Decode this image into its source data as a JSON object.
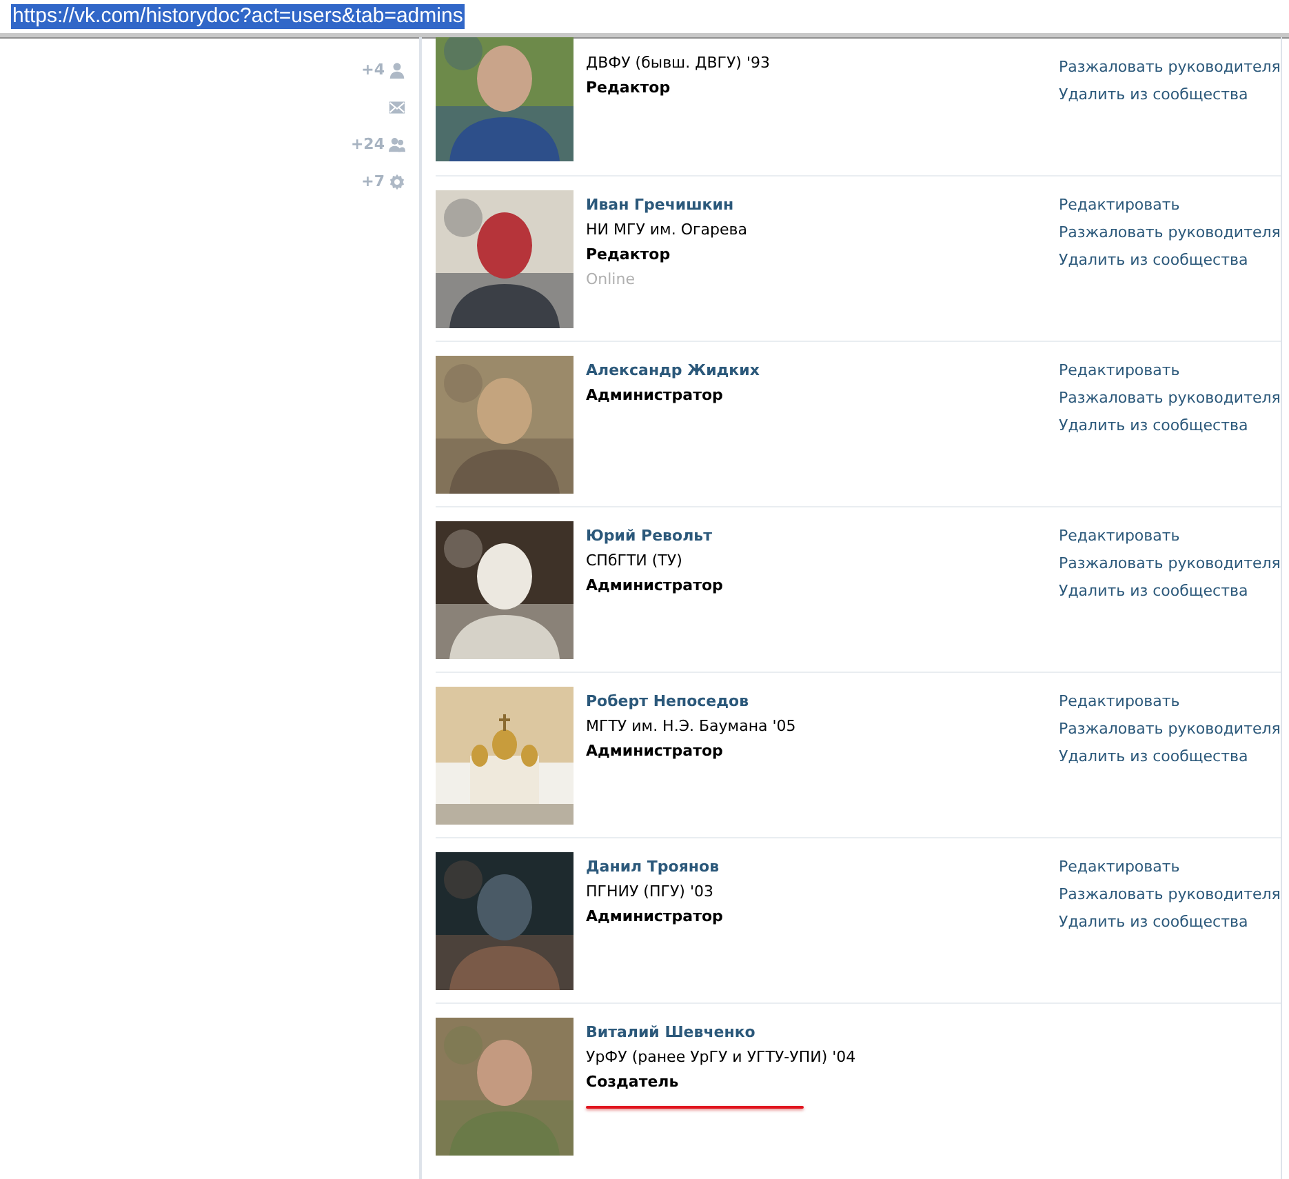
{
  "address_bar": {
    "url": "https://vk.com/historydoc?act=users&tab=admins",
    "selected": true
  },
  "sidebar": {
    "items": [
      {
        "kind": "person",
        "count": "+4"
      },
      {
        "kind": "mail"
      },
      {
        "kind": "group",
        "count": "+24"
      },
      {
        "kind": "gear",
        "count": "+7"
      }
    ]
  },
  "members": [
    {
      "university": "ДВФУ (бывш. ДВГУ) '93",
      "role": "Редактор",
      "actions": [
        "Разжаловать руководителя",
        "Удалить из сообщества"
      ],
      "highlighted": false
    },
    {
      "name": "Иван Гречишкин",
      "university": "НИ МГУ им. Огарева",
      "role": "Редактор",
      "status": "Online",
      "actions": [
        "Редактировать",
        "Разжаловать руководителя",
        "Удалить из сообщества"
      ],
      "highlighted": false
    },
    {
      "name": "Александр Жидких",
      "role": "Администратор",
      "actions": [
        "Редактировать",
        "Разжаловать руководителя",
        "Удалить из сообщества"
      ],
      "highlighted": false
    },
    {
      "name": "Юрий Револьт",
      "university": "СПбГТИ (ТУ)",
      "role": "Администратор",
      "actions": [
        "Редактировать",
        "Разжаловать руководителя",
        "Удалить из сообщества"
      ],
      "highlighted": false
    },
    {
      "name": "Роберт Непоседов",
      "university": "МГТУ им. Н.Э. Баумана '05",
      "role": "Администратор",
      "actions": [
        "Редактировать",
        "Разжаловать руководителя",
        "Удалить из сообщества"
      ],
      "highlighted": false
    },
    {
      "name": "Данил Троянов",
      "university": "ПГНИУ (ПГУ) '03",
      "role": "Администратор",
      "actions": [
        "Редактировать",
        "Разжаловать руководителя",
        "Удалить из сообщества"
      ],
      "highlighted": false
    },
    {
      "name": "Виталий Шевченко",
      "university": "УрФУ (ранее УрГУ и УГТУ-УПИ) '04",
      "role": "Создатель",
      "highlighted": true
    }
  ]
}
